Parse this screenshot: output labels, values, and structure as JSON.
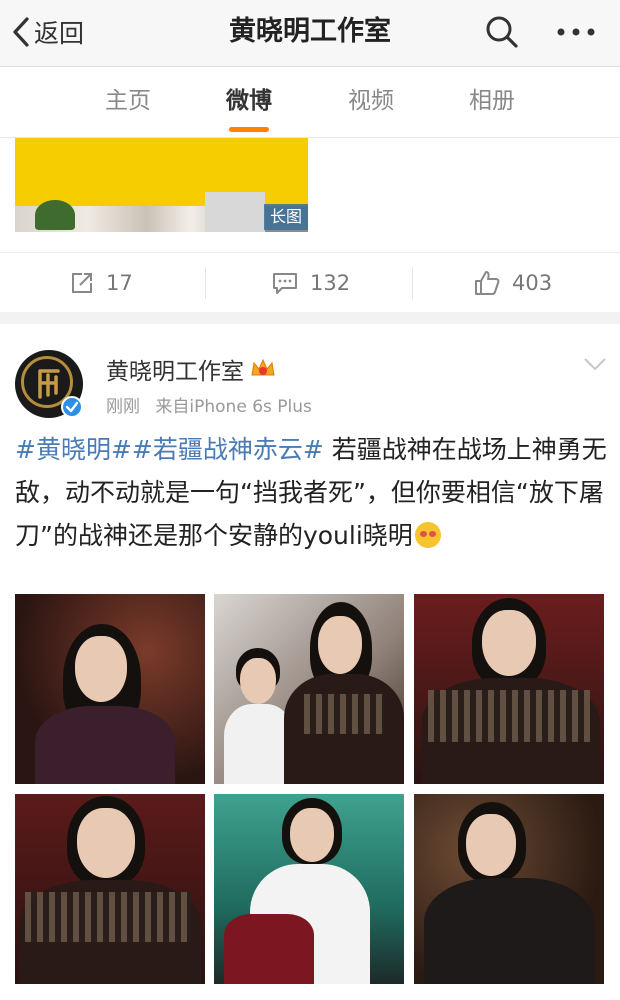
{
  "nav": {
    "back_label": "返回",
    "title": "黄晓明工作室"
  },
  "tabs": [
    {
      "label": "主页",
      "active": false
    },
    {
      "label": "微博",
      "active": true
    },
    {
      "label": "视频",
      "active": false
    },
    {
      "label": "相册",
      "active": false
    }
  ],
  "prev_post": {
    "image_badge": "长图",
    "repost_count": "17",
    "comment_count": "132",
    "like_count": "403"
  },
  "post": {
    "author": "黄晓明工作室",
    "time": "刚刚",
    "source": "来自iPhone 6s Plus",
    "hashtag1": "#黄晓明#",
    "hashtag2": "#若疆战神赤云#",
    "text_body": " 若疆战神在战场上神勇无敌，动不动就是一句“挡我者死”，但你要相信“放下屠刀”的战神还是那个安静的youli晓明",
    "photo_count": 6
  },
  "colors": {
    "accent": "#ff8200",
    "link": "#4a7bb5",
    "verified": "#2d8ee8"
  },
  "icons": [
    "back-chevron-icon",
    "search-icon",
    "more-icon",
    "repost-icon",
    "comment-icon",
    "like-icon",
    "verified-icon",
    "crown-icon",
    "chevron-down-icon"
  ]
}
